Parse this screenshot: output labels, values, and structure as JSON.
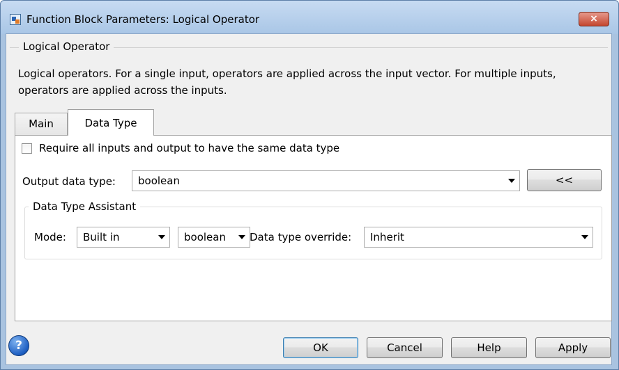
{
  "window": {
    "title": "Function Block Parameters: Logical Operator",
    "close_label": "×"
  },
  "block": {
    "group_title": "Logical Operator",
    "description": "Logical operators.  For a single input, operators are applied across the input vector.  For multiple inputs, operators are applied across the inputs."
  },
  "tabs": [
    {
      "label": "Main",
      "selected": false
    },
    {
      "label": "Data Type",
      "selected": true
    }
  ],
  "data_type_tab": {
    "same_type_checkbox": {
      "label": "Require all inputs and output to have the same data type",
      "checked": false
    },
    "output_label": "Output data type:",
    "output_value": "boolean",
    "assistant_toggle_label": "<<",
    "assistant": {
      "title": "Data Type Assistant",
      "mode_label": "Mode:",
      "mode_value": "Built in",
      "builtin_value": "boolean",
      "override_label": "Data type override:",
      "override_value": "Inherit"
    }
  },
  "footer": {
    "help_icon_glyph": "?",
    "ok": "OK",
    "cancel": "Cancel",
    "help": "Help",
    "apply": "Apply"
  },
  "icons": [
    "simulink-block-icon",
    "close-icon",
    "chevron-down-icon",
    "help-icon"
  ],
  "colors": {
    "titlebar": "#b6cfea",
    "close_button": "#c4462f",
    "dialog_background": "#f0f0f0",
    "panel_background": "#ffffff"
  }
}
